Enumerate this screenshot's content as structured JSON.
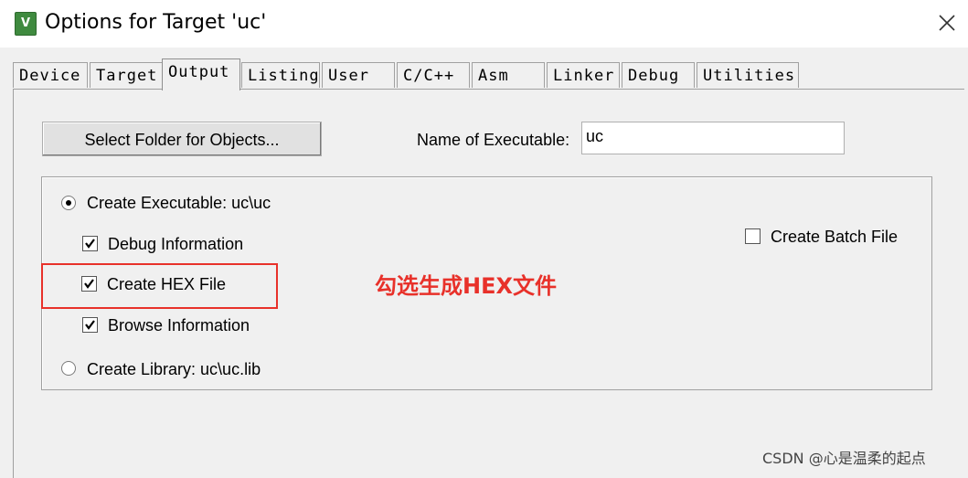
{
  "window": {
    "title": "Options for Target 'uc'",
    "app_icon": "keil-uvision-icon"
  },
  "tabs": [
    {
      "label": "Device"
    },
    {
      "label": "Target"
    },
    {
      "label": "Output",
      "active": true
    },
    {
      "label": "Listing"
    },
    {
      "label": "User"
    },
    {
      "label": "C/C++"
    },
    {
      "label": "Asm"
    },
    {
      "label": "Linker"
    },
    {
      "label": "Debug"
    },
    {
      "label": "Utilities"
    }
  ],
  "output": {
    "select_folder_label": "Select Folder for Objects...",
    "name_of_executable_label": "Name of Executable:",
    "name_of_executable_value": "uc",
    "create_executable_label": "Create Executable:  uc\\uc",
    "create_executable_selected": true,
    "debug_info_label": "Debug Information",
    "debug_info_checked": true,
    "create_hex_label": "Create HEX File",
    "create_hex_checked": true,
    "browse_info_label": "Browse Information",
    "browse_info_checked": true,
    "create_library_label": "Create Library:  uc\\uc.lib",
    "create_library_selected": false,
    "create_batch_label": "Create Batch File",
    "create_batch_checked": false
  },
  "annotation": {
    "text": "勾选生成HEX文件",
    "color": "#e8312a"
  },
  "watermark": "CSDN @心是温柔的起点"
}
